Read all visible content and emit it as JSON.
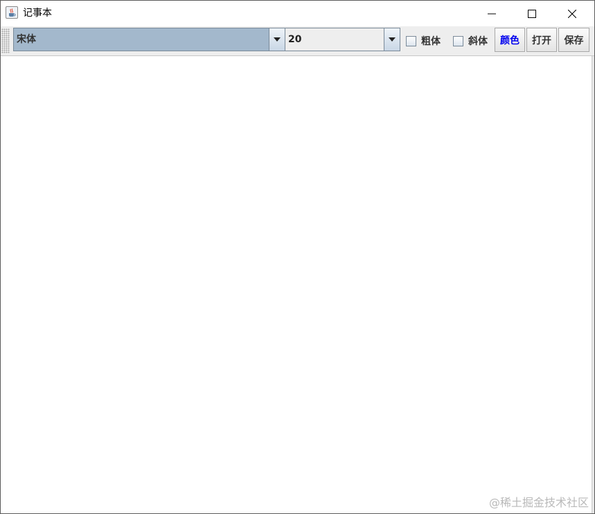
{
  "window": {
    "title": "记事本",
    "app_icon": "java-cup-icon",
    "controls": {
      "minimize": "minimize-icon",
      "maximize": "maximize-icon",
      "close": "close-icon"
    }
  },
  "toolbar": {
    "font_family": {
      "selected": "宋体",
      "arrow_icon": "chevron-down-icon"
    },
    "font_size": {
      "selected": "20",
      "arrow_icon": "chevron-down-icon"
    },
    "bold_label": "粗体",
    "bold_checked": false,
    "italic_label": "斜体",
    "italic_checked": false,
    "color_label": "颜色",
    "open_label": "打开",
    "save_label": "保存"
  },
  "editor": {
    "content": ""
  },
  "watermark": "@稀土掘金技术社区",
  "colors": {
    "selected_field": "#a3b8cc",
    "toolbar_bg": "#eeeeee",
    "color_button_text": "#0000ee"
  }
}
